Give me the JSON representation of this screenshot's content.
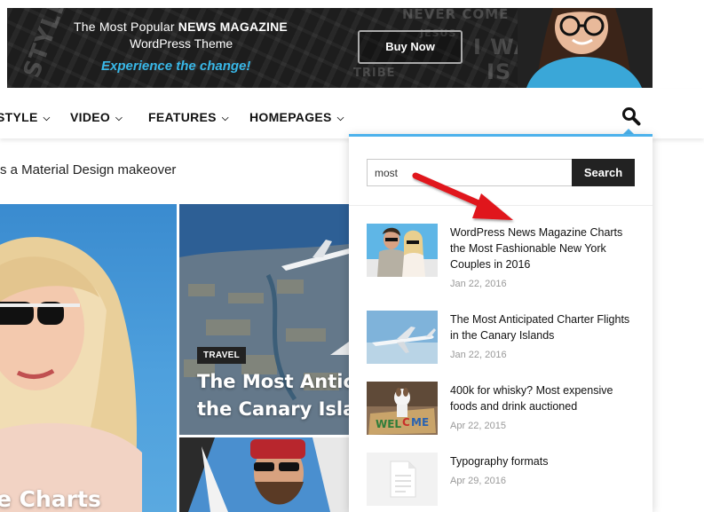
{
  "banner": {
    "line1_prefix": "The Most Popular ",
    "line1_bold": "NEWS MAGAZINE",
    "line2": "WordPress Theme",
    "tagline": "Experience the change!",
    "buy_label": "Buy Now",
    "deco_words": [
      "STYLE",
      "NEVER COME",
      "I WAS",
      "IS &",
      "TRIBE",
      "JESUS"
    ]
  },
  "nav": {
    "items": [
      {
        "label": "STYLE"
      },
      {
        "label": "VIDEO"
      },
      {
        "label": "FEATURES"
      },
      {
        "label": "HOMEPAGES"
      }
    ]
  },
  "ticker": {
    "text": "s a Material Design makeover"
  },
  "tiles": {
    "left_title": "e Charts",
    "mid_category": "TRAVEL",
    "mid_title_line1": "The Most Anticip",
    "mid_title_line2": "the Canary Islan"
  },
  "search": {
    "value": "most",
    "button_label": "Search",
    "results": [
      {
        "title": "WordPress News Magazine Charts the Most Fashionable New York Couples in 2016",
        "date": "Jan 22, 2016",
        "thumb_icon": "couple-photo"
      },
      {
        "title": "The Most Anticipated Charter Flights in the Canary Islands",
        "date": "Jan 22, 2016",
        "thumb_icon": "airplane-photo"
      },
      {
        "title": "400k for whisky? Most expensive foods and drink auctioned",
        "date": "Apr 22, 2015",
        "thumb_icon": "dog-welcome-mat-photo"
      },
      {
        "title": "Typography formats",
        "date": "Apr 29, 2016",
        "thumb_icon": "document-placeholder-icon"
      }
    ]
  },
  "colors": {
    "accent": "#4db2ec",
    "dark": "#222222",
    "banner_tagline": "#39b8e8",
    "arrow": "#e0121a"
  }
}
